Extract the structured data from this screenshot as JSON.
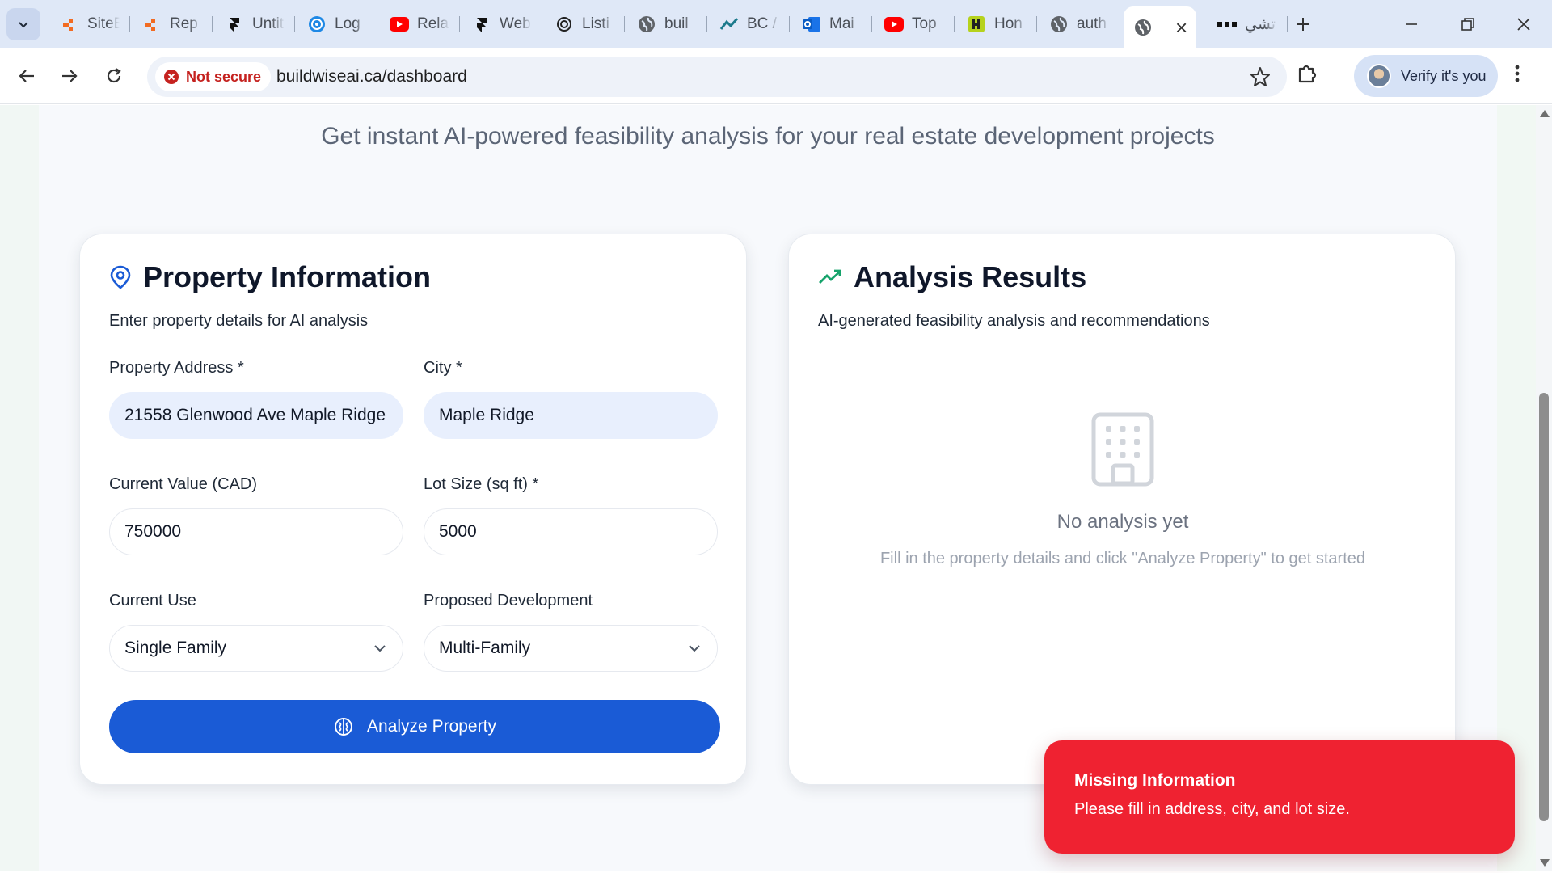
{
  "browser": {
    "tabs": [
      {
        "label": "SiteB",
        "icon": "orange-logo-icon"
      },
      {
        "label": "Rep",
        "icon": "orange-logo-icon"
      },
      {
        "label": "Untit",
        "icon": "framer-icon"
      },
      {
        "label": "Log",
        "icon": "blue-swirl-icon"
      },
      {
        "label": "Rela",
        "icon": "youtube-icon"
      },
      {
        "label": "Web",
        "icon": "framer-icon"
      },
      {
        "label": "Listi",
        "icon": "openai-icon"
      },
      {
        "label": "buil",
        "icon": "globe-icon"
      },
      {
        "label": "BC /",
        "icon": "chart-logo-icon"
      },
      {
        "label": "Mai",
        "icon": "outlook-icon"
      },
      {
        "label": "Top",
        "icon": "youtube-icon"
      },
      {
        "label": "Hon",
        "icon": "yellow-logo-icon"
      },
      {
        "label": "auth",
        "icon": "globe-icon"
      }
    ],
    "active_tab_icon": "globe-icon",
    "after_active_tab": {
      "label": "تشي",
      "icon": "dots-icon"
    },
    "security_label": "Not secure",
    "url": "buildwiseai.ca/dashboard",
    "profile_label": "Verify it's you"
  },
  "page": {
    "subtitle": "Get instant AI-powered feasibility analysis for your real estate development projects",
    "property_card": {
      "title": "Property Information",
      "description": "Enter property details for AI analysis",
      "fields": {
        "address": {
          "label": "Property Address *",
          "value": "21558 Glenwood Ave Maple Ridge"
        },
        "city": {
          "label": "City *",
          "value": "Maple Ridge"
        },
        "current_value": {
          "label": "Current Value (CAD)",
          "value": "750000"
        },
        "lot_size": {
          "label": "Lot Size (sq ft) *",
          "value": "5000"
        },
        "current_use": {
          "label": "Current Use",
          "value": "Single Family"
        },
        "proposed_development": {
          "label": "Proposed Development",
          "value": "Multi-Family"
        }
      },
      "analyze_button": "Analyze Property"
    },
    "results_card": {
      "title": "Analysis Results",
      "description": "AI-generated feasibility analysis and recommendations",
      "empty_title": "No analysis yet",
      "empty_hint": "Fill in the property details and click \"Analyze Property\" to get started"
    },
    "toast": {
      "title": "Missing Information",
      "message": "Please fill in address, city, and lot size."
    }
  },
  "colors": {
    "primary": "#1a5bd6",
    "toast": "#ef2231",
    "trend_icon": "#16a36b",
    "pin_icon": "#1a5bd6"
  }
}
